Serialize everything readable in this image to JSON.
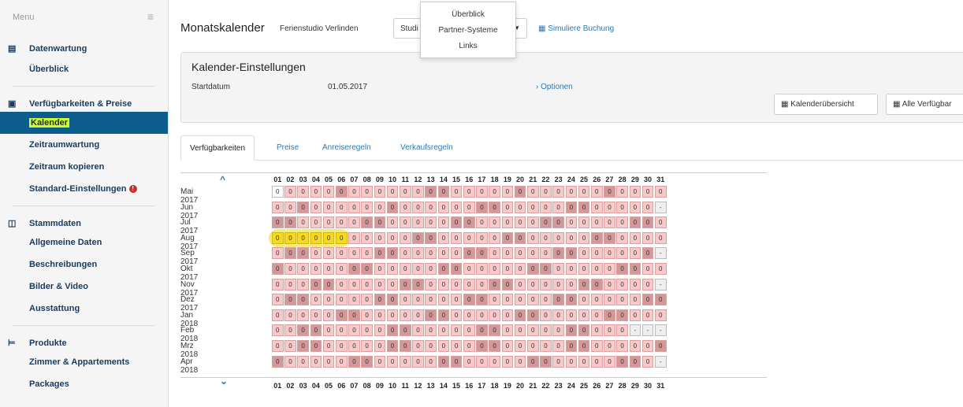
{
  "sidebar": {
    "menu_label": "Menu",
    "sections": [
      {
        "title": "Datenwartung",
        "icon": "document-icon",
        "items": [
          {
            "label": "Überblick",
            "active": false,
            "warn": false
          }
        ]
      },
      {
        "title": "Verfügbarkeiten & Preise",
        "icon": "money-icon",
        "items": [
          {
            "label": "Kalender",
            "active": true,
            "warn": false
          },
          {
            "label": "Zeitraumwartung",
            "active": false,
            "warn": false
          },
          {
            "label": "Zeitraum kopieren",
            "active": false,
            "warn": false
          },
          {
            "label": "Standard-Einstellungen",
            "active": false,
            "warn": true
          }
        ]
      },
      {
        "title": "Stammdaten",
        "icon": "columns-icon",
        "items": [
          {
            "label": "Allgemeine Daten",
            "active": false,
            "warn": false
          },
          {
            "label": "Beschreibungen",
            "active": false,
            "warn": false
          },
          {
            "label": "Bilder & Video",
            "active": false,
            "warn": false
          },
          {
            "label": "Ausstattung",
            "active": false,
            "warn": false
          }
        ]
      },
      {
        "title": "Produkte",
        "icon": "bed-icon",
        "items": [
          {
            "label": "Zimmer & Appartements",
            "active": false,
            "warn": false
          },
          {
            "label": "Packages",
            "active": false,
            "warn": false
          }
        ]
      }
    ]
  },
  "header": {
    "title": "Monatskalender",
    "property": "Ferienstudio Verlinden",
    "select_value": "Studi",
    "simulate_link": "Simuliere Buchung",
    "dropdown_items": [
      "Überblick",
      "Partner-Systeme",
      "Links"
    ]
  },
  "settings": {
    "title": "Kalender-Einstellungen",
    "start_label": "Startdatum",
    "start_value": "01.05.2017",
    "options_link": "Optionen",
    "btn_overview": "Kalenderübersicht",
    "btn_all": "Alle Verfügbar"
  },
  "tabs": [
    "Verfügbarkeiten",
    "Preise",
    "Anreiseregeln",
    "Verkaufsregeln"
  ],
  "calendar": {
    "days": [
      "01",
      "02",
      "03",
      "04",
      "05",
      "06",
      "07",
      "08",
      "09",
      "10",
      "11",
      "12",
      "13",
      "14",
      "15",
      "16",
      "17",
      "18",
      "19",
      "20",
      "21",
      "22",
      "23",
      "24",
      "25",
      "26",
      "27",
      "28",
      "29",
      "30",
      "31"
    ],
    "months": [
      {
        "label": "Mai 2017",
        "len": 31,
        "dark": [
          6,
          13,
          14,
          20,
          27
        ],
        "first_white": true
      },
      {
        "label": "Jun 2017",
        "len": 30,
        "dark": [
          3,
          10,
          17,
          18,
          24,
          25
        ],
        "first_white": false
      },
      {
        "label": "Jul 2017",
        "len": 31,
        "dark": [
          1,
          2,
          8,
          9,
          15,
          16,
          22,
          23,
          29,
          30
        ],
        "first_white": false
      },
      {
        "label": "Aug 2017",
        "len": 31,
        "dark": [
          5,
          6,
          12,
          13,
          19,
          20,
          26,
          27
        ],
        "first_white": false
      },
      {
        "label": "Sep 2017",
        "len": 30,
        "dark": [
          2,
          3,
          9,
          10,
          16,
          17,
          23,
          24,
          30
        ],
        "first_white": false
      },
      {
        "label": "Okt 2017",
        "len": 31,
        "dark": [
          1,
          7,
          8,
          14,
          15,
          21,
          22,
          28,
          29
        ],
        "first_white": false
      },
      {
        "label": "Nov 2017",
        "len": 30,
        "dark": [
          4,
          5,
          11,
          12,
          18,
          19,
          25,
          26
        ],
        "first_white": false
      },
      {
        "label": "Dez 2017",
        "len": 31,
        "dark": [
          2,
          3,
          9,
          10,
          16,
          17,
          23,
          24,
          30,
          31
        ],
        "first_white": false
      },
      {
        "label": "Jan 2018",
        "len": 31,
        "dark": [
          6,
          7,
          13,
          14,
          20,
          21,
          27,
          28
        ],
        "first_white": false
      },
      {
        "label": "Feb 2018",
        "len": 28,
        "dark": [
          3,
          4,
          10,
          11,
          17,
          18,
          24,
          25
        ],
        "first_white": false
      },
      {
        "label": "Mrz 2018",
        "len": 31,
        "dark": [
          3,
          4,
          10,
          11,
          17,
          18,
          24,
          25,
          31
        ],
        "first_white": false
      },
      {
        "label": "Apr 2018",
        "len": 30,
        "dark": [
          1,
          7,
          8,
          14,
          15,
          21,
          22,
          28,
          29
        ],
        "first_white": false
      }
    ],
    "cell_value": "0",
    "empty_value": "-",
    "highlight_month": 3,
    "highlight_days": [
      1,
      2,
      3,
      4,
      5,
      6
    ]
  },
  "colors": {
    "accent": "#2a7ab5",
    "active_nav": "#0d5d8c",
    "cell_pink": "#f9c8c8",
    "cell_dark": "#d49898",
    "highlight": "#f5d820"
  }
}
